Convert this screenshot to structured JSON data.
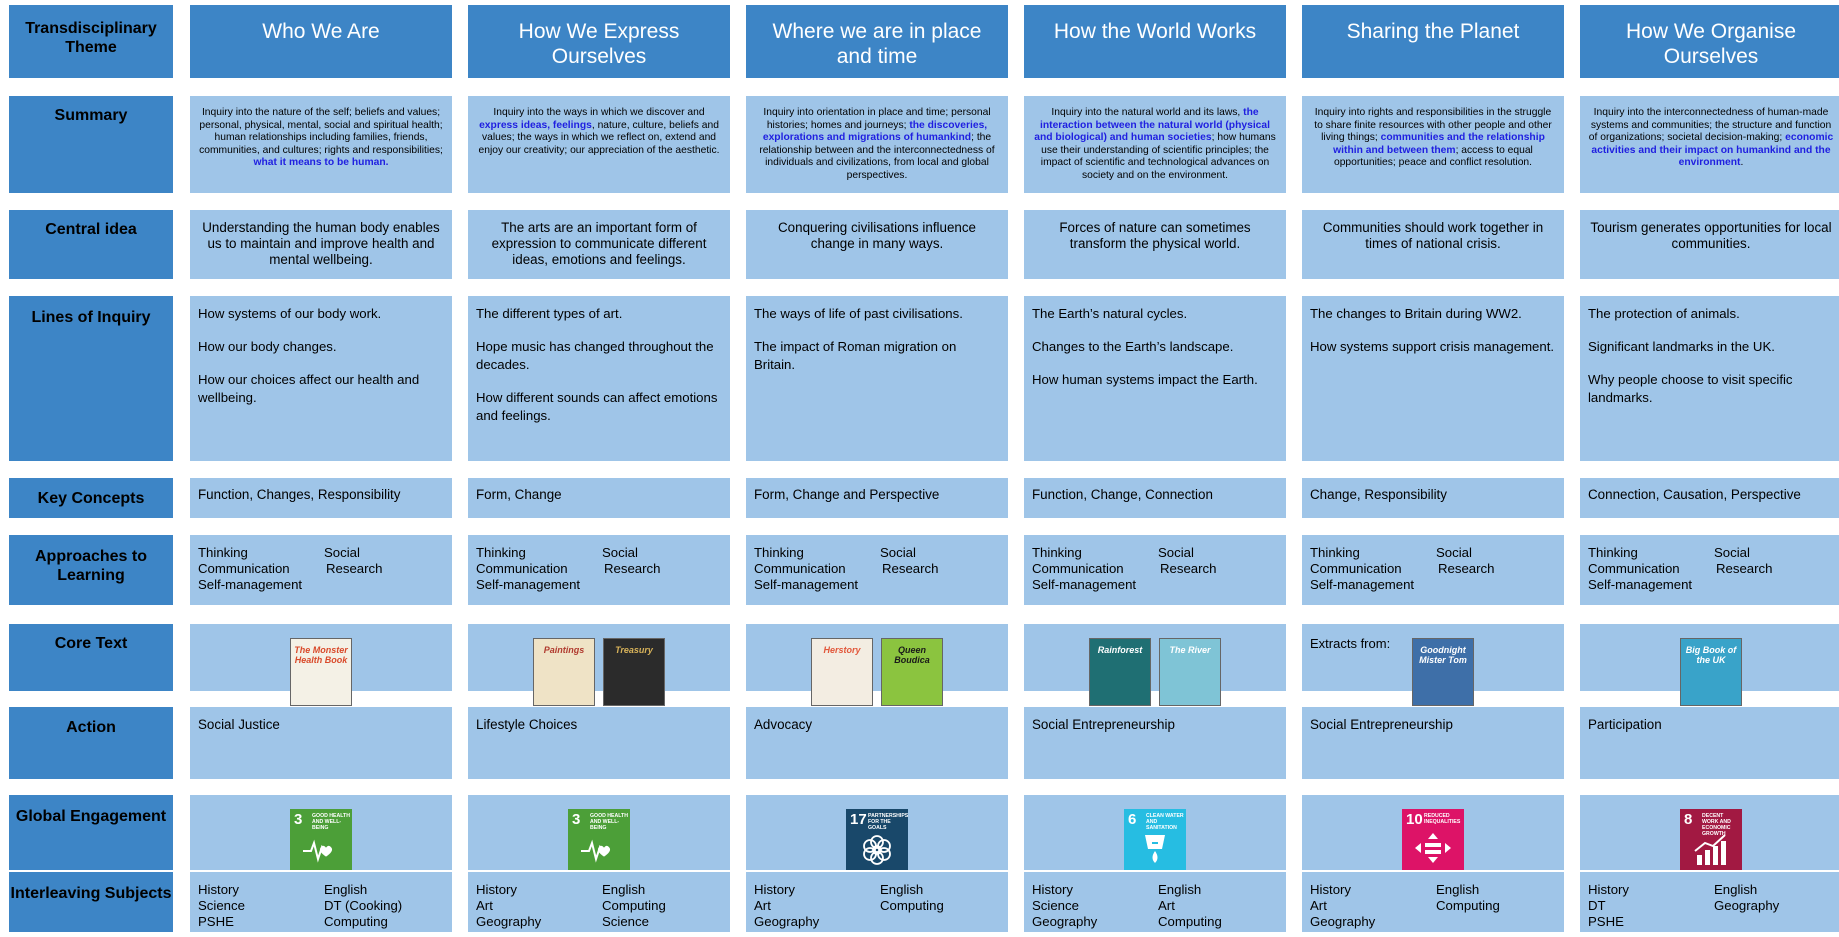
{
  "row_headers": {
    "theme": "Transdisciplinary Theme",
    "summary": "Summary",
    "central_idea": "Central idea",
    "lines_of_inquiry": "Lines of Inquiry",
    "key_concepts": "Key Concepts",
    "approaches": "Approaches to Learning",
    "core_text": "Core Text",
    "action": "Action",
    "global_engagement": "Global Engagement",
    "interleaving": "Interleaving Subjects"
  },
  "approaches": {
    "thinking": "Thinking",
    "social": "Social",
    "communication": "Communication",
    "research": "Research",
    "self_management": "Self-management"
  },
  "columns": [
    {
      "theme": "Who We Are",
      "summary": [
        {
          "text": "Inquiry into the nature of the self; beliefs and values; personal, physical, mental, social and spiritual health; human relationships including families, friends, communities, and cultures; rights and responsibilities; "
        },
        {
          "text": "what it means to be human.",
          "hl": true
        }
      ],
      "central_idea": "Understanding the human body enables us to maintain and improve health and mental wellbeing.",
      "lines": [
        "How systems of our body work.",
        "How our body changes.",
        "How our choices affect our health and wellbeing."
      ],
      "key_concepts": "Function, Changes, Responsibility",
      "core_text_label": "",
      "books": [
        {
          "title": "The Monster Health Book",
          "color": "#f4f1e6",
          "text": "#d94a2a"
        }
      ],
      "action": "Social Justice",
      "sdg": {
        "number": "3",
        "label": "Good health and well-being",
        "color": "#4c9f38",
        "icon": "heartbeat-icon"
      },
      "subjects": [
        "History",
        "English",
        "Science",
        "DT (Cooking)",
        "PSHE",
        "Computing"
      ]
    },
    {
      "theme": "How We Express Ourselves",
      "summary": [
        {
          "text": "Inquiry into the ways in which we discover and "
        },
        {
          "text": "express ideas, feelings",
          "hl": true
        },
        {
          "text": ", nature, culture, beliefs and values; the ways in which we reflect on, extend and enjoy our creativity; our appreciation of the aesthetic."
        }
      ],
      "central_idea": "The arts are an  important form of expression to communicate different ideas, emotions and feelings.",
      "lines": [
        "The different types of art.",
        "Hope music has changed throughout the decades.",
        "How different sounds can affect emotions and feelings."
      ],
      "key_concepts": "Form, Change",
      "core_text_label": "",
      "books": [
        {
          "title": "Paintings",
          "color": "#efe3c6",
          "text": "#b03a2e"
        },
        {
          "title": "Treasury",
          "color": "#2b2b2b",
          "text": "#d8b35a"
        }
      ],
      "action": "Lifestyle Choices",
      "sdg": {
        "number": "3",
        "label": "Good health and well-being",
        "color": "#4c9f38",
        "icon": "heartbeat-icon"
      },
      "subjects": [
        "History",
        "English",
        "Art",
        "Computing",
        "Geography",
        "Science"
      ]
    },
    {
      "theme": "Where we are in place and time",
      "summary": [
        {
          "text": "Inquiry into orientation in place and time; personal histories; homes and journeys; "
        },
        {
          "text": "the discoveries, explorations and migrations of humankind",
          "hl": true
        },
        {
          "text": "; the relationship between and the interconnectedness of individuals and civilizations, from local and global perspectives."
        }
      ],
      "central_idea": "Conquering civilisations influence change in many ways.",
      "lines": [
        "The ways of life of past civilisations.",
        "The impact of Roman migration on Britain."
      ],
      "key_concepts": "Form, Change and Perspective",
      "core_text_label": "",
      "books": [
        {
          "title": "Herstory",
          "color": "#f3ede2",
          "text": "#e2573a"
        },
        {
          "title": "Queen Boudica",
          "color": "#8bc43f",
          "text": "#1a1a1a"
        }
      ],
      "action": "Advocacy",
      "sdg": {
        "number": "17",
        "label": "Partnerships for the goals",
        "color": "#19486a",
        "icon": "flower-icon"
      },
      "subjects": [
        "History",
        "English",
        "Art",
        "Computing",
        "Geography",
        ""
      ]
    },
    {
      "theme": "How the World Works",
      "summary": [
        {
          "text": "Inquiry into the natural world and its laws, "
        },
        {
          "text": "the interaction between the natural world (physical and biological) and human societies",
          "hl": true
        },
        {
          "text": "; how humans use their understanding of scientific principles; the impact of scientific and technological advances on society and on the environment."
        }
      ],
      "central_idea": "Forces of nature can sometimes transform the physical world.",
      "lines": [
        "The Earth’s natural cycles.",
        "Changes to the Earth’s landscape.",
        "How human systems impact the Earth."
      ],
      "key_concepts": "Function, Change, Connection",
      "core_text_label": "",
      "books": [
        {
          "title": "Rainforest",
          "color": "#1f6f73",
          "text": "#ffffff"
        },
        {
          "title": "The River",
          "color": "#7fc4d6",
          "text": "#ffffff"
        }
      ],
      "action": "Social Entrepreneurship",
      "sdg": {
        "number": "6",
        "label": "Clean water and sanitation",
        "color": "#26bde2",
        "icon": "water-icon"
      },
      "subjects": [
        "History",
        "English",
        "Science",
        "Art",
        "Geography",
        "Computing"
      ]
    },
    {
      "theme": "Sharing the Planet",
      "summary": [
        {
          "text": "Inquiry into rights and responsibilities in the struggle to share finite resources with other people and other living things; "
        },
        {
          "text": "communities and the relationship within and between them",
          "hl": true
        },
        {
          "text": "; access to equal opportunities; peace and conflict resolution."
        }
      ],
      "central_idea": "Communities should work together in times of national crisis.",
      "lines": [
        "The changes to Britain during WW2.",
        "How systems support crisis management."
      ],
      "key_concepts": "Change, Responsibility",
      "core_text_label": "Extracts from:",
      "books": [
        {
          "title": "Goodnight Mister Tom",
          "color": "#3e6fa8",
          "text": "#ffffff"
        }
      ],
      "action": "Social Entrepreneurship",
      "sdg": {
        "number": "10",
        "label": "Reduced inequalities",
        "color": "#dd1367",
        "icon": "equality-icon"
      },
      "subjects": [
        "History",
        "English",
        "Art",
        "Computing",
        "Geography",
        ""
      ]
    },
    {
      "theme": "How We Organise Ourselves",
      "summary": [
        {
          "text": "Inquiry into the interconnectedness of human-made systems and communities; the structure and function of organizations; societal decision-making; "
        },
        {
          "text": "economic activities and their impact on humankind and the environment",
          "hl": true
        },
        {
          "text": "."
        }
      ],
      "central_idea": "Tourism generates opportunities for local communities.",
      "lines": [
        "The protection of animals.",
        "Significant landmarks in the UK.",
        "Why people choose to visit specific landmarks."
      ],
      "key_concepts": "Connection, Causation, Perspective",
      "core_text_label": "",
      "books": [
        {
          "title": "Big Book of the UK",
          "color": "#39a3c9",
          "text": "#ffffff"
        }
      ],
      "action": "Participation",
      "sdg": {
        "number": "8",
        "label": "Decent work and economic growth",
        "color": "#a21942",
        "icon": "growth-chart-icon"
      },
      "subjects": [
        "History",
        "English",
        "DT",
        "Geography",
        "PSHE",
        ""
      ]
    }
  ]
}
